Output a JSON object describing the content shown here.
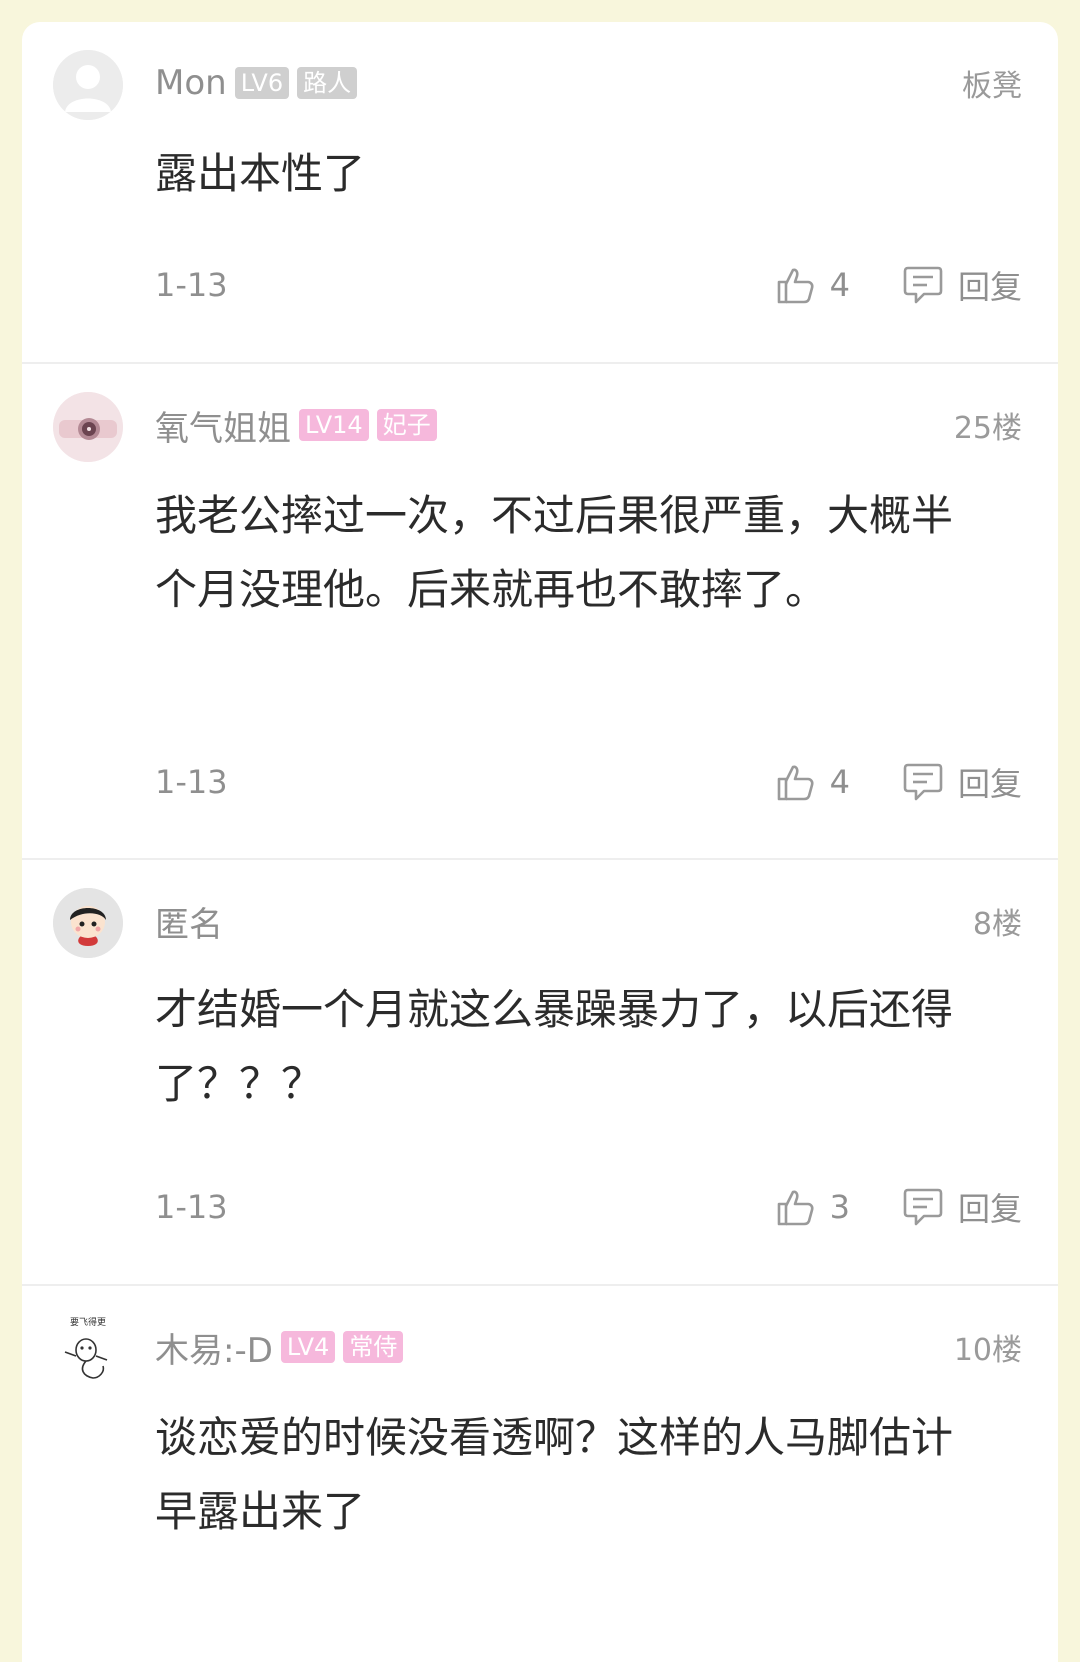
{
  "colors": {
    "page_background": "#f8f6dc",
    "card_background": "#ffffff",
    "badge_gray": "#cfcfcf",
    "badge_pink": "#f6b8dc",
    "muted_text": "#8f8f8f",
    "body_text": "#2b2b2b"
  },
  "comments": [
    {
      "avatar_icon": "default-avatar-icon",
      "username": "Mon",
      "level": "LV6",
      "title": "路人",
      "badge_color": "gray",
      "floor": "板凳",
      "text": "露出本性了",
      "date": "1-13",
      "likes": "4",
      "reply_label": "回复"
    },
    {
      "avatar_icon": "photo-avatar-icon",
      "username": "氧气姐姐",
      "level": "LV14",
      "title": "妃子",
      "badge_color": "pink",
      "floor": "25楼",
      "text": "我老公摔过一次，不过后果很严重，大概半个月没理他。后来就再也不敢摔了。",
      "date": "1-13",
      "likes": "4",
      "reply_label": "回复"
    },
    {
      "avatar_icon": "anonymous-avatar-icon",
      "username": "匿名",
      "level": "",
      "title": "",
      "badge_color": "",
      "floor": "8楼",
      "text": "才结婚一个月就这么暴躁暴力了，以后还得了？？？",
      "date": "1-13",
      "likes": "3",
      "reply_label": "回复"
    },
    {
      "avatar_icon": "cartoon-avatar-icon",
      "avatar_text": "要飞得更",
      "username": "木易:-D",
      "level": "LV4",
      "title": "常侍",
      "badge_color": "pink",
      "floor": "10楼",
      "text": "谈恋爱的时候没看透啊？这样的人马脚估计早露出来了",
      "date": "",
      "likes": "",
      "reply_label": ""
    }
  ]
}
